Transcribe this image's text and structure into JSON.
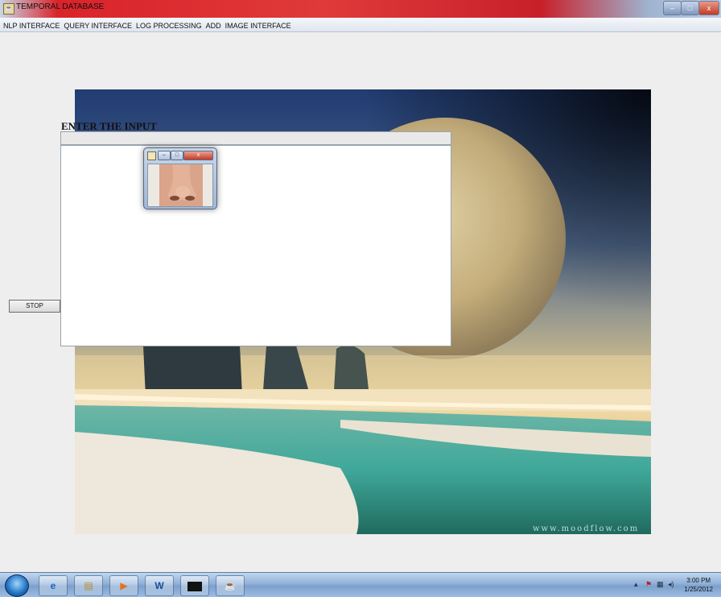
{
  "window": {
    "title": "TEMPORAL DATABASE",
    "controls": {
      "minimize": "–",
      "maximize": "□",
      "close": "x"
    }
  },
  "menu": [
    "NLP INTERFACE",
    "QUERY INTERFACE",
    "LOG PROCESSING",
    "ADD",
    "IMAGE INTERFACE"
  ],
  "panel": {
    "heading": "ENTER THE INPUT",
    "input_value": "",
    "textarea_value": "",
    "stop_label": "STOP"
  },
  "background": {
    "watermark": "www.moodflow.com"
  },
  "mini_window": {
    "close_label": "x"
  },
  "taskbar": {
    "apps": [
      "ie-icon",
      "explorer-icon",
      "media-player-icon",
      "word-icon",
      "cmd-icon",
      "java-icon"
    ],
    "clock_time": "3:00 PM",
    "clock_date": "1/25/2012"
  },
  "colors": {
    "titlebar_red": "#d9232a",
    "taskbar_blue": "#8fb0d8",
    "content_bg": "#eeeeee"
  }
}
